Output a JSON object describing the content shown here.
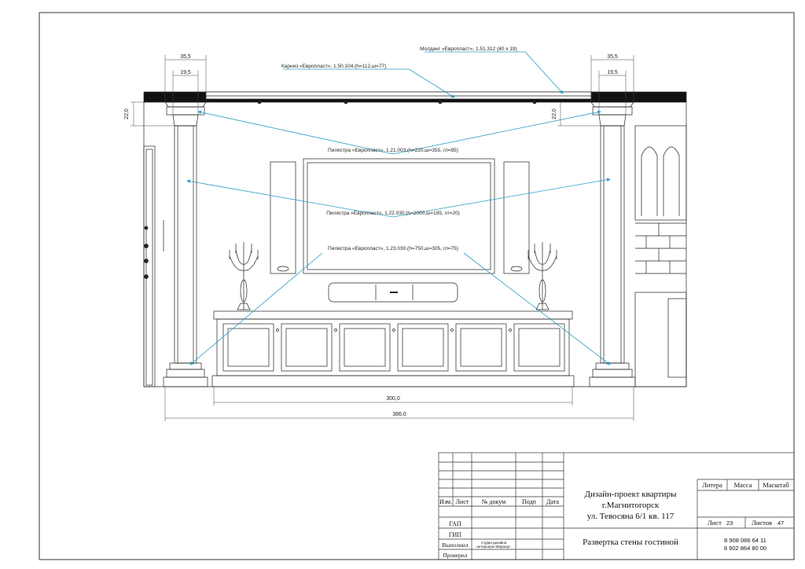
{
  "dimensions": {
    "left_outer": "35,5",
    "left_inner": "19,5",
    "left_height": "22,0",
    "right_outer": "35,5",
    "right_inner": "19,5",
    "right_height": "22,0",
    "cabinet_width": "300,0",
    "total_width": "386,0"
  },
  "callouts": {
    "molding": "Молдинг «Европласт», 1.51.312 (40 х 19)",
    "cornice": "Карниз «Европласт», 1.50.104.(h=112,ш=77)",
    "pilaster_capital": "Пилястра «Европласт», 1.21.003.(h=220,ш=355, гл=95)",
    "pilaster_shaft": "Пилястра «Европласт», 1.22.030.(h=2000,ш=195, гл=20)",
    "pilaster_base": "Пилястра «Европласт», 1.23.030.(h=750,ш=305, гл=75)"
  },
  "title_block": {
    "col_izm": "Изм.",
    "col_list": "Лист",
    "col_doc": "№ докум",
    "col_sign": "Подп",
    "col_date": "Дата",
    "role_gap": "ГАП",
    "role_gip": "ГИП",
    "role_done": "Выполнил",
    "role_checked": "Проверил",
    "studio_line1": "студия дизайна",
    "studio_line2": "интерьера«Маранд»",
    "project_line1": "Дизайн-проект квартиры",
    "project_line2": "г.Магнитогорск",
    "project_line3": "ул. Тевосяна 6/1 кв. 117",
    "sheet_title": "Развертка стены гостиной",
    "litera_label": "Литера",
    "mass_label": "Масса",
    "scale_label": "Масштаб",
    "sheet_label": "Лист",
    "sheet_number": "23",
    "sheets_label": "Листов",
    "sheets_total": "47",
    "phone1": "8 908 086 64 11",
    "phone2": "8 902 864 80 00"
  },
  "colors": {
    "line": "#222222",
    "callout_arrow": "#2a9fc4",
    "frame": "#333333"
  }
}
